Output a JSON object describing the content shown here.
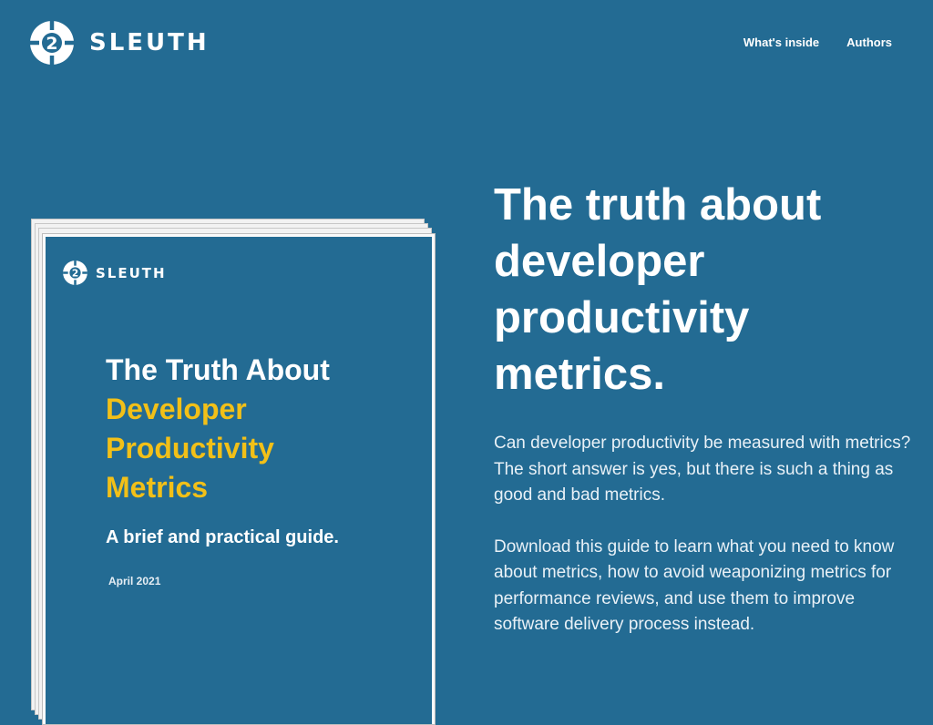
{
  "header": {
    "brand_name": "SLEUTH",
    "nav": [
      {
        "label": "What's inside"
      },
      {
        "label": "Authors"
      }
    ]
  },
  "cover": {
    "brand_name": "SLEUTH",
    "title_line1": "The Truth About",
    "title_line2": "Developer",
    "title_line3": "Productivity",
    "title_line4": "Metrics",
    "subtitle": "A brief and practical guide.",
    "date": "April 2021"
  },
  "hero": {
    "title": "The truth about developer productivity metrics.",
    "question": "Can developer productivity be measured with metrics?",
    "answer": "The short answer is yes, but there is such a thing as good and bad metrics.",
    "cta_text": "Download this guide to learn what you need to know about metrics, how to avoid weaponizing metrics for performance reviews, and use them to improve software delivery process instead."
  },
  "colors": {
    "background": "#236b93",
    "accent_yellow": "#f2c018",
    "text": "#ffffff"
  },
  "icons": {
    "brand_logo": "sleuth-logo-icon"
  }
}
